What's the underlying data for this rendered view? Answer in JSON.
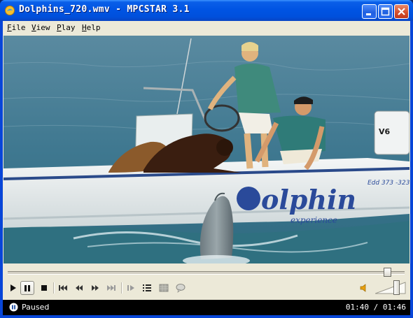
{
  "window": {
    "title": "Dolphins_720.wmv - MPCSTAR 3.1",
    "minimize_icon": "minimize-icon",
    "maximize_icon": "maximize-icon",
    "close_icon": "close-icon"
  },
  "menu": [
    {
      "label": "File"
    },
    {
      "label": "View"
    },
    {
      "label": "Play"
    },
    {
      "label": "Help"
    }
  ],
  "video": {
    "boat_lettering": "olphin",
    "boat_lettering_sub": "experience",
    "boat_registration": "Edd 373 -323",
    "motor_label": "V6"
  },
  "playback": {
    "seek_position_fraction": 0.957,
    "volume_fraction": 0.7,
    "state_icon": "pause-icon"
  },
  "toolbar": [
    {
      "name": "play-button",
      "icon": "play-icon"
    },
    {
      "name": "pause-button",
      "icon": "pause-icon",
      "pressed": true
    },
    {
      "name": "stop-button",
      "icon": "stop-icon"
    },
    {
      "name": "previous-button",
      "icon": "skip-back-icon"
    },
    {
      "name": "rewind-button",
      "icon": "rewind-icon"
    },
    {
      "name": "fast-forward-button",
      "icon": "fast-forward-icon"
    },
    {
      "name": "next-button",
      "icon": "skip-forward-icon"
    },
    {
      "name": "frame-step-button",
      "icon": "frame-step-icon"
    },
    {
      "name": "playlist-button",
      "icon": "playlist-icon"
    },
    {
      "name": "subtitle-button",
      "icon": "subtitle-icon"
    },
    {
      "name": "chat-button",
      "icon": "speech-bubble-icon"
    },
    {
      "name": "mute-button",
      "icon": "speaker-icon"
    }
  ],
  "status": {
    "text": "Paused",
    "time_current": "01:40",
    "time_separator": "/",
    "time_total": "01:46"
  },
  "colors": {
    "titlebar": "#0054e3",
    "client_bg": "#ece9d8",
    "status_bg": "#000000",
    "close_button": "#d6502c"
  }
}
